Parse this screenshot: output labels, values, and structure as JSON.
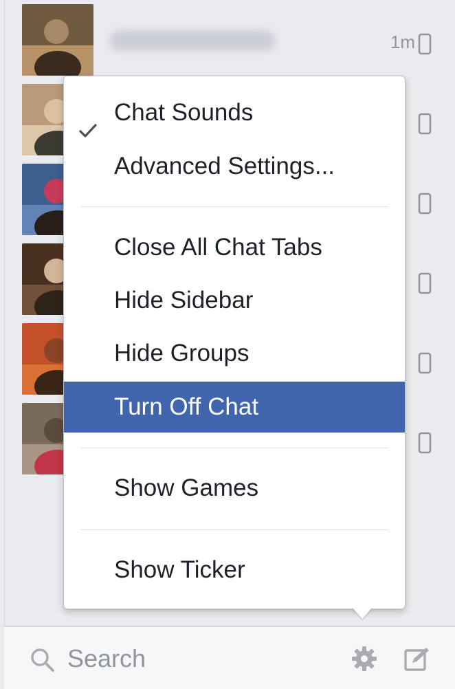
{
  "contacts": [
    {
      "time": "1m",
      "avatar_colors": [
        "#6e5a3c",
        "#c9a070",
        "#3b2a1e",
        "#a68a66"
      ]
    },
    {
      "time": "",
      "avatar_colors": [
        "#b89a78",
        "#e6d2b4",
        "#3a3a32",
        "#d8c2a2"
      ]
    },
    {
      "time": "",
      "avatar_colors": [
        "#3c5f8f",
        "#6a8cc0",
        "#2a1e1a",
        "#c43c5a"
      ]
    },
    {
      "time": "",
      "avatar_colors": [
        "#4a3020",
        "#7a5a40",
        "#2c2418",
        "#d2b496"
      ]
    },
    {
      "time": "",
      "avatar_colors": [
        "#c4502a",
        "#e07a3a",
        "#3a2416",
        "#8a4428"
      ]
    },
    {
      "time": "",
      "avatar_colors": [
        "#7a6a5a",
        "#b4a290",
        "#c23448",
        "#5a4a3c"
      ]
    }
  ],
  "menu": {
    "chat_sounds": "Chat Sounds",
    "chat_sounds_checked": true,
    "advanced_settings": "Advanced Settings...",
    "close_all_chat_tabs": "Close All Chat Tabs",
    "hide_sidebar": "Hide Sidebar",
    "hide_groups": "Hide Groups",
    "turn_off_chat": "Turn Off Chat",
    "show_games": "Show Games",
    "show_ticker": "Show Ticker",
    "highlight_color": "#4065ad"
  },
  "search": {
    "placeholder": "Search",
    "value": ""
  },
  "icons": {
    "search": "search-icon",
    "settings": "gear-icon",
    "compose": "compose-icon",
    "check": "check-icon",
    "mobile": "mobile-phone-icon"
  }
}
